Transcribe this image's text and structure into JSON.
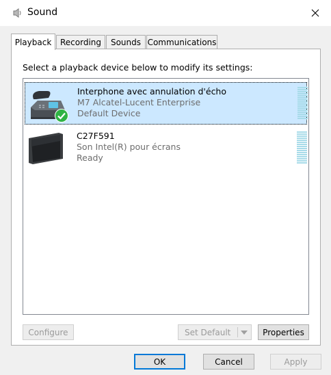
{
  "window": {
    "title": "Sound",
    "title_icon": "speaker-icon",
    "close_icon": "close-icon"
  },
  "tabs": [
    {
      "label": "Playback",
      "active": true
    },
    {
      "label": "Recording",
      "active": false
    },
    {
      "label": "Sounds",
      "active": false
    },
    {
      "label": "Communications",
      "active": false
    }
  ],
  "instruction": "Select a playback device below to modify its settings:",
  "devices": [
    {
      "name": "Interphone avec annulation d'écho",
      "driver": "M7 Alcatel-Lucent Enterprise",
      "status": "Default Device",
      "icon": "desk-phone-icon",
      "badge": "green-check-icon",
      "selected": true
    },
    {
      "name": "C27F591",
      "driver": "Son Intel(R) pour écrans",
      "status": "Ready",
      "icon": "monitor-icon",
      "selected": false
    }
  ],
  "panel_buttons": {
    "configure": "Configure",
    "set_default": "Set Default",
    "properties": "Properties"
  },
  "dialog_buttons": {
    "ok": "OK",
    "cancel": "Cancel",
    "apply": "Apply"
  },
  "colors": {
    "selection": "#cce8ff",
    "meter": "#a7dbe9",
    "accent": "#0078d7",
    "check": "#2fb344"
  }
}
